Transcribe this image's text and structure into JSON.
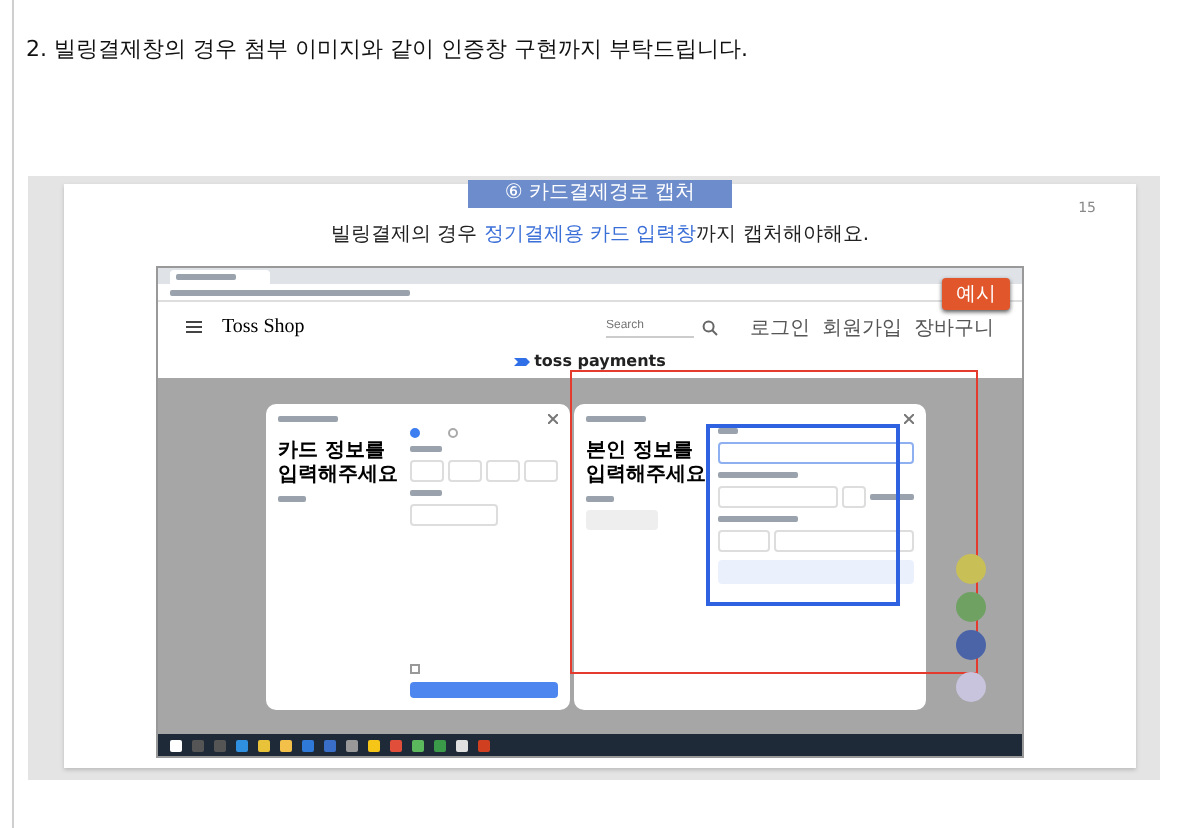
{
  "heading": "2. 빌링결제창의 경우 첨부 이미지와 같이 인증창 구현까지 부탁드립니다.",
  "slide": {
    "banner": "⑥ 카드결제경로 캡처",
    "page_number": "15",
    "subtitle": {
      "before": "빌링결제의 경우 ",
      "highlight": "정기결제용 카드 입력창",
      "after": "까지 캡처해야해요."
    },
    "badge": "예시",
    "browser": {
      "shop_name": "Toss Shop",
      "search_placeholder": "Search",
      "nav": [
        "로그인",
        "회원가입",
        "장바구니"
      ],
      "brand": "toss payments",
      "modals": [
        {
          "title": "카드 정보를\n입력해주세요",
          "kind": "card",
          "radios": [
            {
              "selected": true
            },
            {
              "selected": false
            }
          ],
          "agree_checked": false
        },
        {
          "title": "본인 정보를\n입력해주세요",
          "kind": "identity"
        }
      ]
    }
  }
}
